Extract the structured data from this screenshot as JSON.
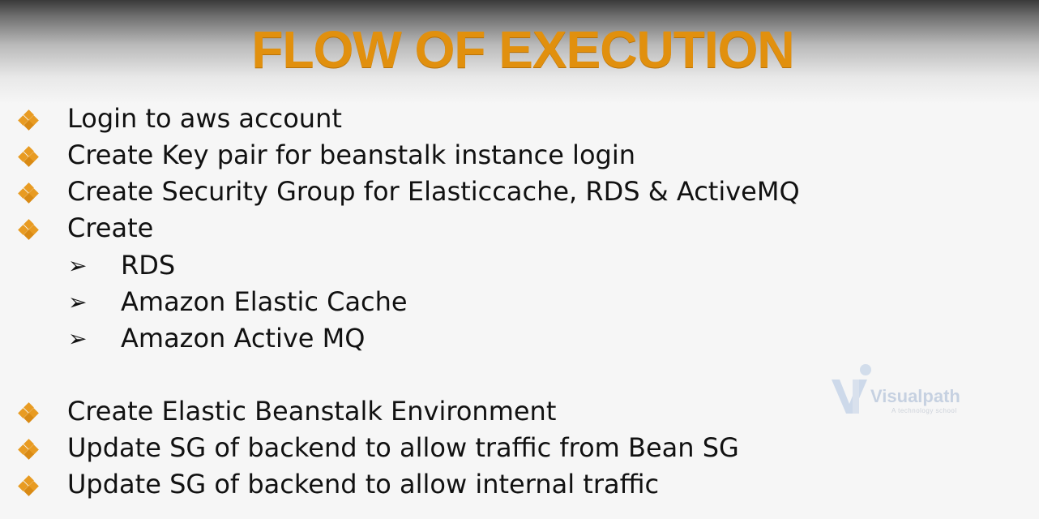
{
  "slide": {
    "title": "FLOW OF EXECUTION",
    "bullets": [
      "Login to aws account",
      "Create Key pair for beanstalk instance login",
      "Create Security Group for Elasticcache, RDS & ActiveMQ",
      "Create"
    ],
    "sub_bullets": [
      "RDS",
      "Amazon Elastic Cache",
      "Amazon Active MQ"
    ],
    "bullets_after": [
      "Create Elastic Beanstalk Environment",
      "Update SG of backend to allow traffic from Bean SG",
      "Update SG of backend to allow internal traffic"
    ],
    "bullet_icon": "diamond-bullet-icon",
    "sub_bullet_icon": "arrowhead-bullet-icon",
    "sub_bullet_glyph": "➢"
  },
  "watermark": {
    "name": "Visualpath",
    "tagline": "A technology school"
  },
  "colors": {
    "title": "#e1900e",
    "bullet": "#e89b22",
    "text": "#111111",
    "watermark": "#8da6c9"
  }
}
